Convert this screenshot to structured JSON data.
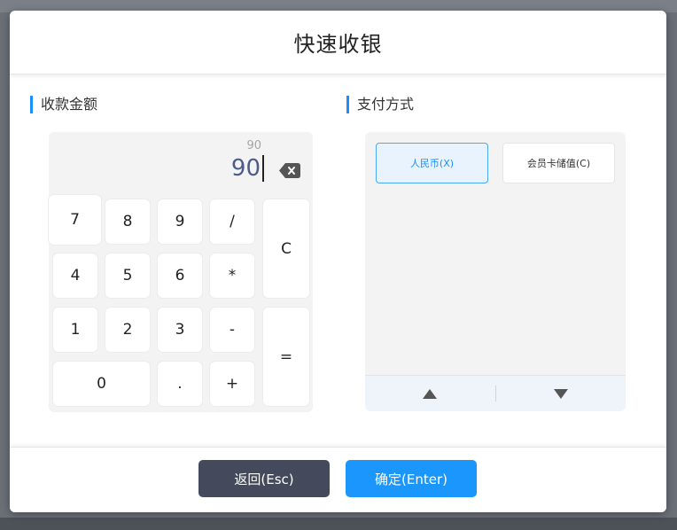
{
  "dialog": {
    "title": "快速收银",
    "amount_section": {
      "title": "收款金额"
    },
    "payment_section": {
      "title": "支付方式"
    },
    "calculator": {
      "expression": "90",
      "display": "90",
      "keys": {
        "k7": "7",
        "k8": "8",
        "k9": "9",
        "div": "/",
        "clear": "C",
        "k4": "4",
        "k5": "5",
        "k6": "6",
        "mul": "*",
        "k1": "1",
        "k2": "2",
        "k3": "3",
        "sub": "-",
        "equals": "=",
        "k0": "0",
        "dot": ".",
        "add": "+"
      },
      "backspace_icon": "backspace-icon"
    },
    "payment_methods": [
      {
        "label": "人民币(X)",
        "selected": true
      },
      {
        "label": "会员卡储值(C)",
        "selected": false
      }
    ],
    "footer": {
      "back_label": "返回(Esc)",
      "confirm_label": "确定(Enter)"
    }
  },
  "colors": {
    "accent": "#1a8ffb",
    "back_button": "#444a5c",
    "confirm_button": "#1a96fc",
    "display_text": "#4b5c8a"
  }
}
